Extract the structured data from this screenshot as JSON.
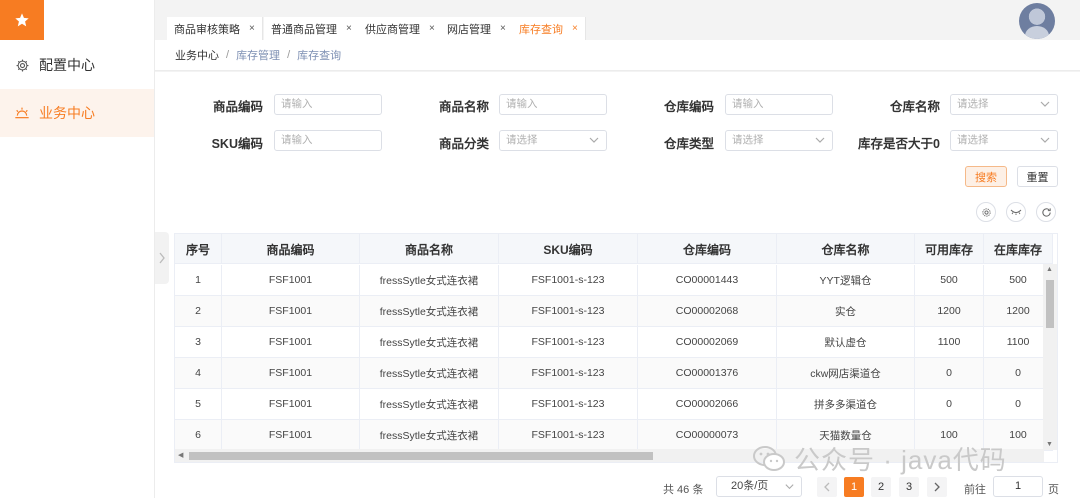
{
  "sidebar": {
    "logo_icon": "star-icon",
    "items": [
      {
        "label": "配置中心",
        "icon": "gear-icon"
      },
      {
        "label": "业务中心",
        "icon": "sunrise-icon"
      }
    ]
  },
  "tabs": [
    {
      "label": "商品审核策略",
      "close": "×"
    },
    {
      "label": "普通商品管理",
      "close": "×"
    },
    {
      "label": "供应商管理",
      "close": "×"
    },
    {
      "label": "网店管理",
      "close": "×"
    },
    {
      "label": "库存查询",
      "close": "×"
    }
  ],
  "breadcrumb": [
    "业务中心",
    "库存管理",
    "库存查询"
  ],
  "breadcrumb_sep": "/",
  "filters": [
    {
      "label": "商品编码",
      "placeholder": "请输入"
    },
    {
      "label": "商品名称",
      "placeholder": "请输入"
    },
    {
      "label": "仓库编码",
      "placeholder": "请输入"
    },
    {
      "label": "仓库名称",
      "placeholder": "请选择"
    },
    {
      "label": "SKU编码",
      "placeholder": "请输入"
    },
    {
      "label": "商品分类",
      "placeholder": "请选择"
    },
    {
      "label": "仓库类型",
      "placeholder": "请选择"
    },
    {
      "label": "库存是否大于0",
      "placeholder": "请选择"
    }
  ],
  "buttons": {
    "search": "搜索",
    "reset": "重置"
  },
  "table": {
    "headers": [
      "序号",
      "商品编码",
      "商品名称",
      "SKU编码",
      "仓库编码",
      "仓库名称",
      "可用库存",
      "在库库存"
    ],
    "rows": [
      [
        "1",
        "FSF1001",
        "fressSytle女式连衣裙",
        "FSF1001-s-123",
        "CO00001443",
        "YYT逻辑仓",
        "500",
        "500"
      ],
      [
        "2",
        "FSF1001",
        "fressSytle女式连衣裙",
        "FSF1001-s-123",
        "CO00002068",
        "实仓",
        "1200",
        "1200"
      ],
      [
        "3",
        "FSF1001",
        "fressSytle女式连衣裙",
        "FSF1001-s-123",
        "CO00002069",
        "默认虚仓",
        "1100",
        "1100"
      ],
      [
        "4",
        "FSF1001",
        "fressSytle女式连衣裙",
        "FSF1001-s-123",
        "CO00001376",
        "ckw网店渠道仓",
        "0",
        "0"
      ],
      [
        "5",
        "FSF1001",
        "fressSytle女式连衣裙",
        "FSF1001-s-123",
        "CO00002066",
        "拼多多渠道仓",
        "0",
        "0"
      ],
      [
        "6",
        "FSF1001",
        "fressSytle女式连衣裙",
        "FSF1001-s-123",
        "CO00000073",
        "天猫数量仓",
        "100",
        "100"
      ]
    ]
  },
  "pagination": {
    "total": "共 46 条",
    "page_size": "20条/页",
    "pages": [
      "1",
      "2",
      "3"
    ],
    "current": "1",
    "goto_label": "前往",
    "goto_value": "1",
    "page_suffix": "页"
  },
  "watermark": "公众号 · java代码",
  "colors": {
    "accent": "#f77c22",
    "accent_light": "#fdf3ec",
    "link": "#7d8fb3"
  }
}
